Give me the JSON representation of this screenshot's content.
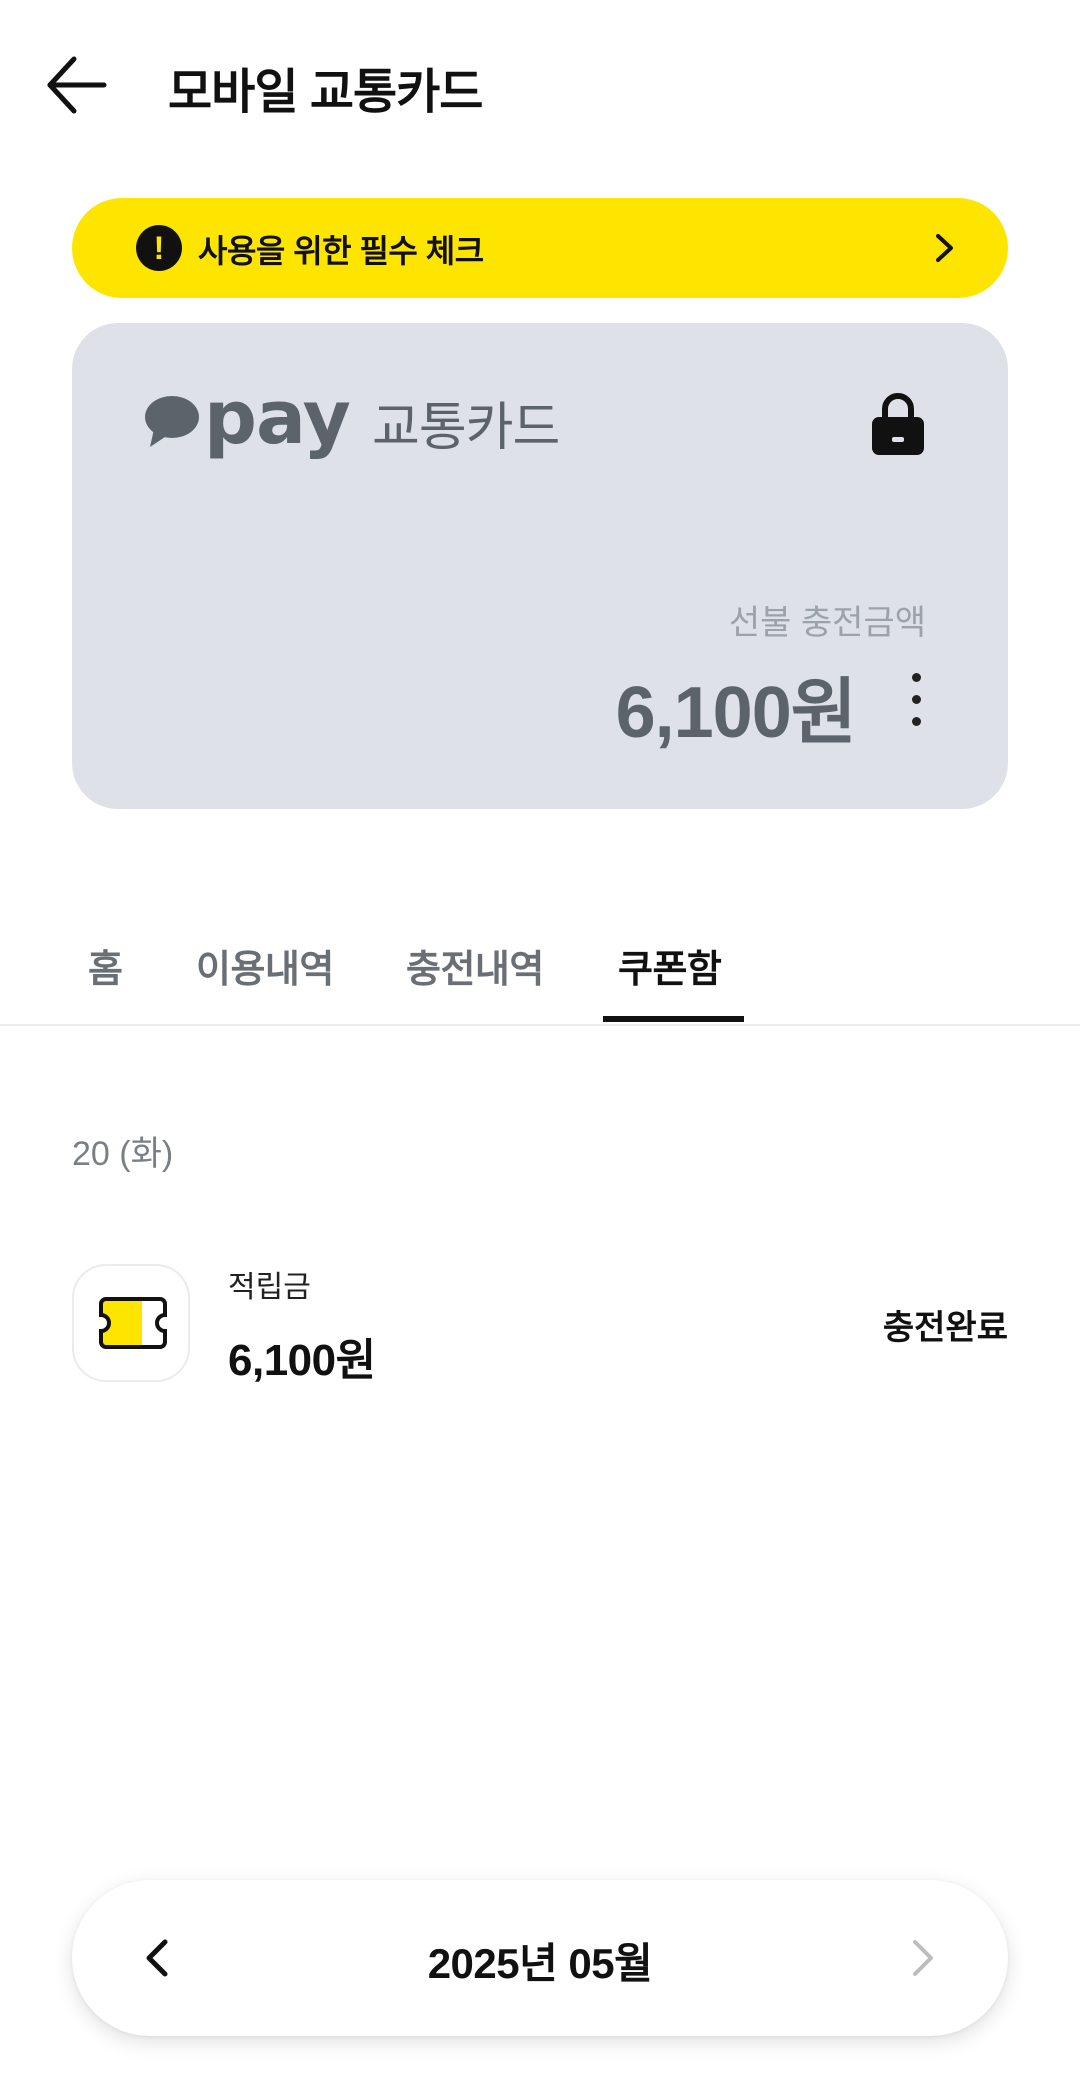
{
  "header": {
    "title": "모바일 교통카드"
  },
  "notice": {
    "text": "사용을 위한 필수 체크",
    "icon": "exclamation-icon"
  },
  "card": {
    "brand": "pay",
    "type_label": "교통카드",
    "balance_label": "선불 충전금액",
    "balance": "6,100원",
    "lock_icon": "lock-icon",
    "more_icon": "more-vertical-icon"
  },
  "tabs": [
    {
      "label": "홈",
      "active": false
    },
    {
      "label": "이용내역",
      "active": false
    },
    {
      "label": "충전내역",
      "active": false
    },
    {
      "label": "쿠폰함",
      "active": true
    }
  ],
  "coupons": {
    "date": "20 (화)",
    "items": [
      {
        "type": "적립금",
        "amount": "6,100원",
        "status": "충전완료",
        "icon": "ticket-icon"
      }
    ]
  },
  "month_nav": {
    "label": "2025년 05월"
  },
  "colors": {
    "accent": "#FEE500",
    "card_bg": "#DEE2E8",
    "card_text": "#5D636B"
  }
}
